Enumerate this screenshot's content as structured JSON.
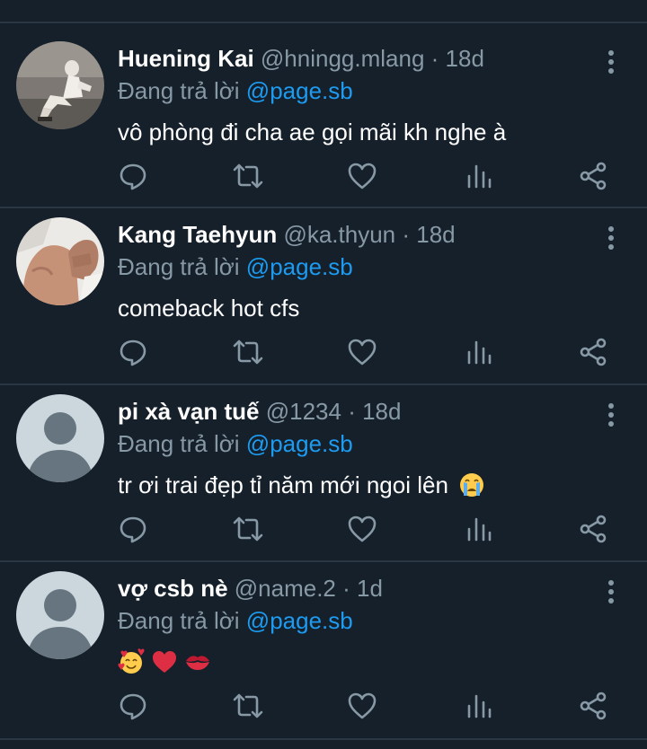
{
  "tweets": [
    {
      "name": "Huening Kai",
      "handle": "@hningg.mlang",
      "time": "18d",
      "replying_prefix": "Đang trả lời",
      "replying_to": "@page.sb",
      "text": "vô phòng đi cha ae gọi mãi kh nghe à",
      "avatar": "photo"
    },
    {
      "name": "Kang Taehyun",
      "handle": "@ka.thyun",
      "time": "18d",
      "replying_prefix": "Đang trả lời",
      "replying_to": "@page.sb",
      "text": "comeback hot cfs",
      "avatar": "photo"
    },
    {
      "name": "pi xà vạn tuế",
      "handle": "@1234",
      "time": "18d",
      "replying_prefix": "Đang trả lời",
      "replying_to": "@page.sb",
      "text": "tr ơi trai đẹp tỉ năm mới ngoi lên",
      "emoji": "crying-face",
      "avatar": "default"
    },
    {
      "name": "vợ csb nè",
      "handle": "@name.2",
      "time": "1d",
      "replying_prefix": "Đang trả lời",
      "replying_to": "@page.sb",
      "text": "",
      "emoji": "smiling-face-with-hearts, red-heart, kiss-mark",
      "avatar": "default"
    }
  ],
  "separator": " · ",
  "icons": {
    "reply": "reply-icon",
    "retweet": "retweet-icon",
    "like": "heart-icon",
    "views": "analytics-icon",
    "share": "share-icon",
    "more": "more-vertical-icon"
  },
  "colors": {
    "background": "#15202b",
    "divider": "#2a3642",
    "muted": "#8899a6",
    "link": "#1d9bf0",
    "text": "#ffffff"
  }
}
